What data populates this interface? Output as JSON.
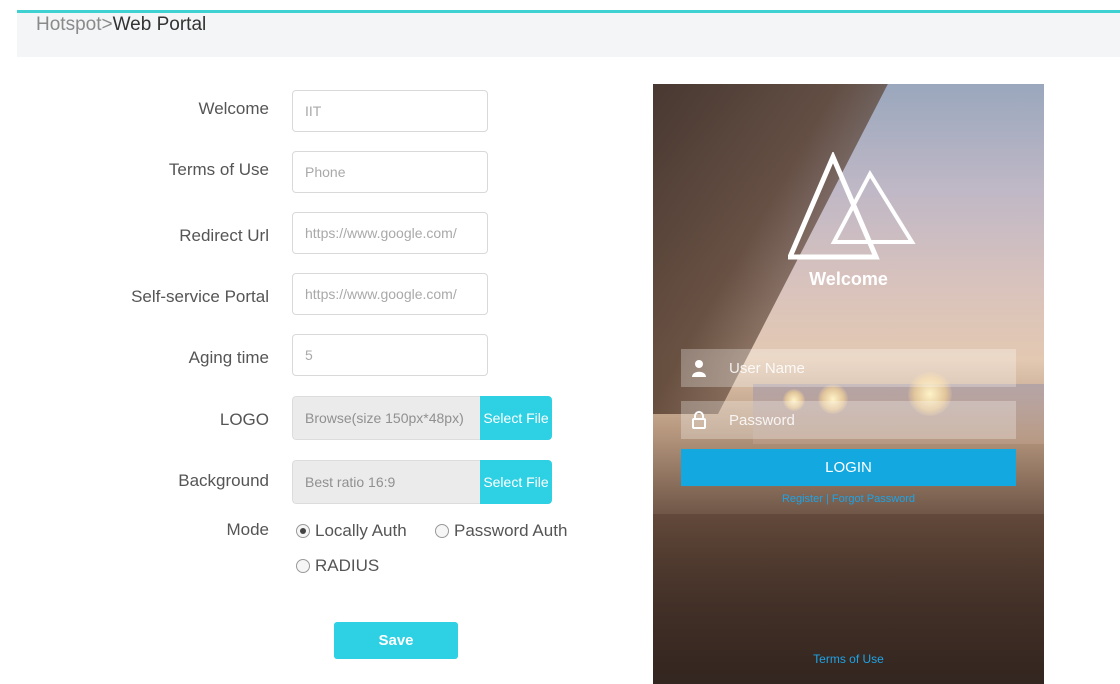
{
  "breadcrumb": {
    "parent": "Hotspot",
    "separator": ">",
    "current": "Web Portal"
  },
  "form": {
    "welcome": {
      "label": "Welcome",
      "placeholder": "IIT"
    },
    "terms": {
      "label": "Terms of Use",
      "placeholder": "Phone"
    },
    "redirect": {
      "label": "Redirect Url",
      "placeholder": "https://www.google.com/"
    },
    "self_service": {
      "label": "Self-service Portal",
      "placeholder": "https://www.google.com/"
    },
    "aging": {
      "label": "Aging time",
      "placeholder": "5"
    },
    "logo": {
      "label": "LOGO",
      "text": "Browse(size 150px*48px)",
      "button": "Select File"
    },
    "background": {
      "label": "Background",
      "text": "Best ratio 16:9",
      "button": "Select File"
    },
    "mode": {
      "label": "Mode",
      "options": [
        {
          "label": "Locally Auth",
          "selected": true
        },
        {
          "label": "Password Auth",
          "selected": false
        },
        {
          "label": "RADIUS",
          "selected": false
        }
      ]
    },
    "save_label": "Save"
  },
  "preview": {
    "welcome": "Welcome",
    "username_placeholder": "User Name",
    "password_placeholder": "Password",
    "login_label": "LOGIN",
    "register_link": "Register",
    "links_separator": " | ",
    "forgot_link": "Forgot Password",
    "terms_link": "Terms of Use"
  },
  "colors": {
    "accent": "#2ed0e3",
    "header_line": "#3fd0d2",
    "login_button": "#13a8e0",
    "link": "#1ea3e6"
  }
}
